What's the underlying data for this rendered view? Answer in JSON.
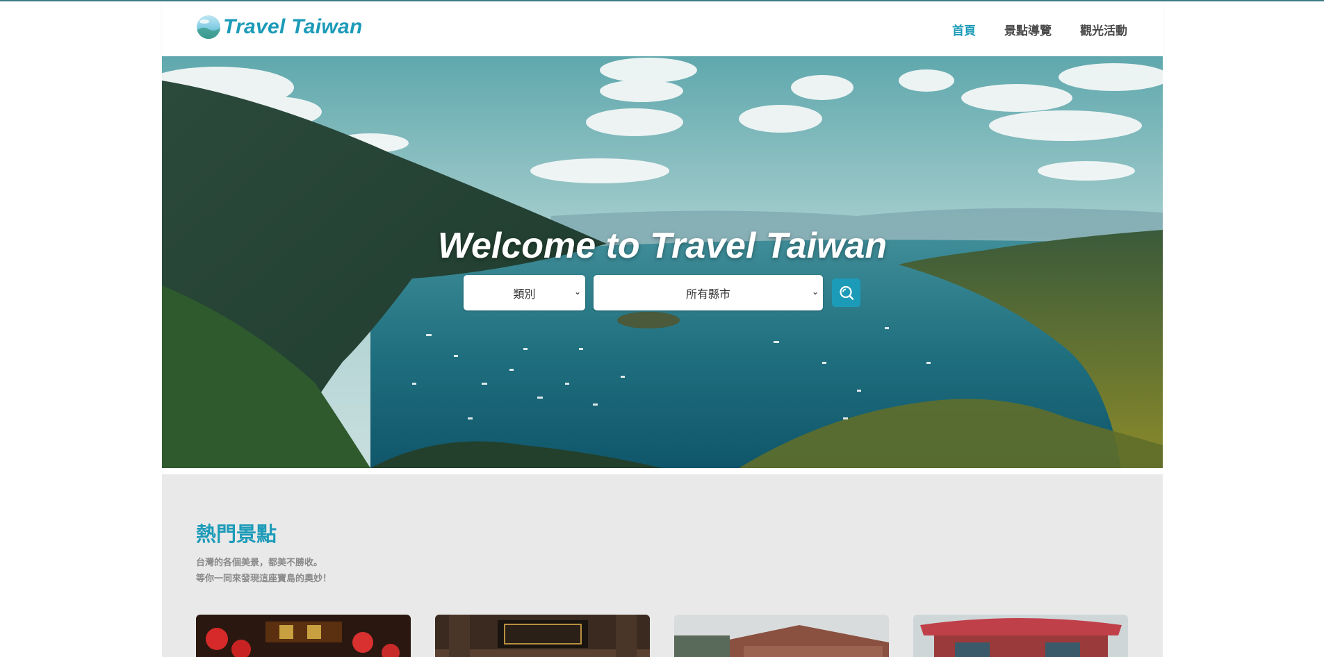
{
  "header": {
    "logo_text": "Travel Taiwan",
    "nav": [
      {
        "label": "首頁",
        "active": true
      },
      {
        "label": "景點導覽",
        "active": false
      },
      {
        "label": "觀光活動",
        "active": false
      }
    ]
  },
  "hero": {
    "title": "Welcome to Travel Taiwan",
    "category_select": {
      "selected": "類別"
    },
    "city_select": {
      "selected": "所有縣市"
    },
    "search_icon": "search-icon"
  },
  "popular": {
    "title": "熱門景點",
    "desc_line1": "台灣的各個美景，都美不勝收。",
    "desc_line2": "等你一同來發現這座寶島的奧妙！"
  },
  "colors": {
    "accent": "#1c9bb8",
    "nav_text": "#4a4a4a",
    "section_bg": "#e9e9ea"
  }
}
